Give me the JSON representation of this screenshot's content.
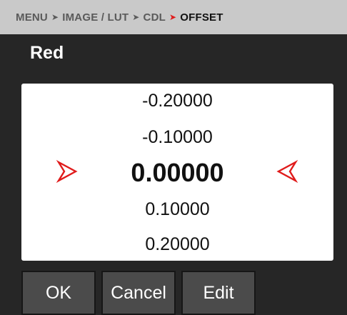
{
  "breadcrumb": {
    "items": [
      "MENU",
      "IMAGE / LUT",
      "CDL",
      "OFFSET"
    ],
    "separator": "➤"
  },
  "title": "Red",
  "picker": {
    "values": [
      "-0.20000",
      "-0.10000",
      "0.00000",
      "0.10000",
      "0.20000"
    ],
    "selected_index": 2,
    "arrow_icon": "red-arrow-icon",
    "accent_color": "#e01b1b"
  },
  "buttons": {
    "ok": "OK",
    "cancel": "Cancel",
    "edit": "Edit"
  }
}
